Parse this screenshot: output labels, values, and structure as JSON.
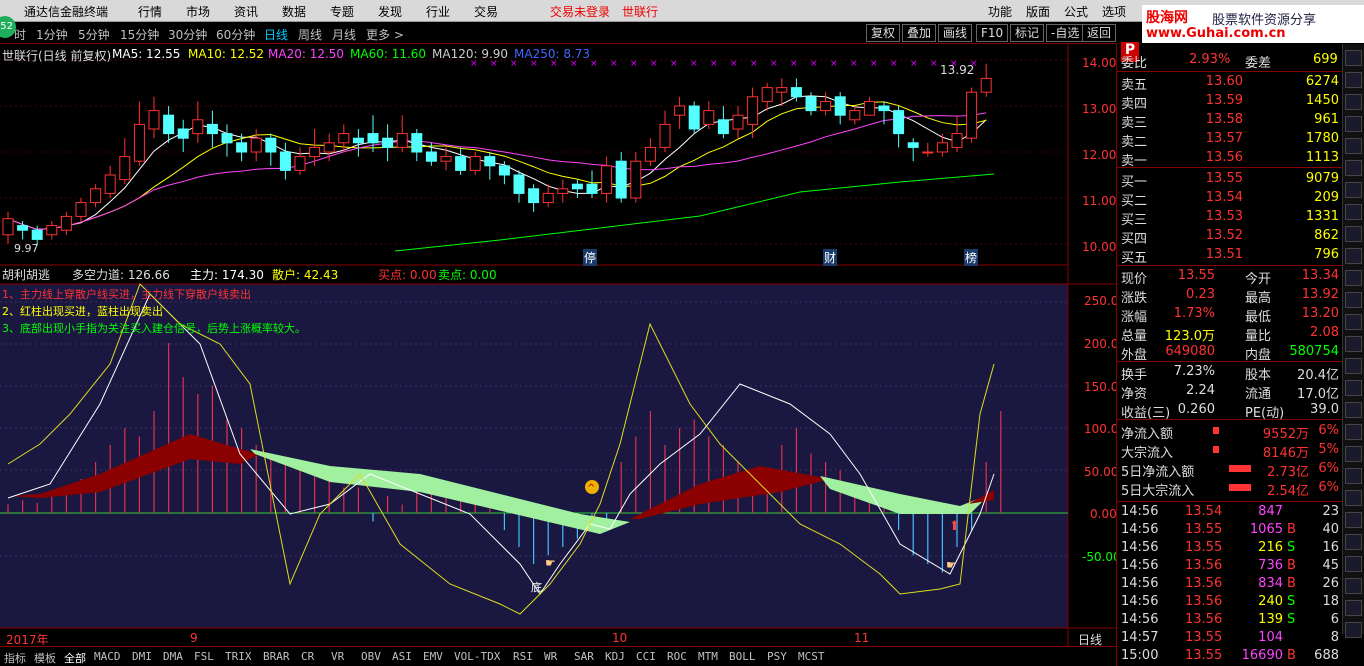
{
  "menu": {
    "items": [
      "通达信金融终端",
      "行情",
      "市场",
      "资讯",
      "数据",
      "专题",
      "发现",
      "行业",
      "交易"
    ],
    "trade_status": "交易未登录",
    "stock_name": "世联行",
    "right_items": [
      "功能",
      "版面",
      "公式",
      "选项"
    ]
  },
  "logo_text": "52",
  "watermark": {
    "line1": "股海网",
    "line2": "股票软件资源分享",
    "line3": "www.Guhai.com.cn"
  },
  "periods": [
    "时",
    "1分钟",
    "5分钟",
    "15分钟",
    "30分钟",
    "60分钟",
    "日线",
    "周线",
    "月线",
    "更多 >"
  ],
  "active_period": "日线",
  "tools": [
    "复权",
    "叠加",
    "画线",
    "F10",
    "标记",
    "-自选",
    "返回"
  ],
  "ma_legend": {
    "title": "世联行(日线 前复权)",
    "ma5": "MA5: 12.55",
    "ma10": "MA10: 12.52",
    "ma20": "MA20: 12.50",
    "ma60": "MA60: 11.60",
    "ma120": "MA120: 9.90",
    "ma250": "MA250: 8.73",
    "colors": {
      "ma5": "#ffffff",
      "ma10": "#ffff00",
      "ma20": "#ff40ff",
      "ma60": "#00ff00",
      "ma120": "#c0c0c0",
      "ma250": "#4060ff"
    }
  },
  "price_axis": [
    "14.00",
    "13.00",
    "12.00",
    "11.00",
    "10.00"
  ],
  "price_annotations": {
    "high": "13.92",
    "low": "9.97",
    "markers": [
      "停",
      "财",
      "榜"
    ]
  },
  "indicator": {
    "name": "胡利胡逃",
    "dkd": "多空力道: 126.66",
    "zl": "主力: 174.30",
    "sh": "散户: 42.43",
    "buy": "买点: 0.00",
    "sell": "卖点: 0.00",
    "note1": "1、主力线上穿散户线买进，主力线下穿散户线卖出",
    "note2": "2、红柱出现买进，蓝柱出现卖出",
    "note3": "3、底部出现小手指为关注买入建仓信号，后势上涨概率较大。",
    "axis": [
      "250.00",
      "200.00",
      "150.00",
      "100.00",
      "50.00",
      "0.00",
      "-50.00"
    ],
    "low_label": "底"
  },
  "time_axis": {
    "year": "2017年",
    "m9": "9",
    "m10": "10",
    "m11": "11",
    "period": "日线"
  },
  "order_book": {
    "wb_label": "委比",
    "wb_value": "2.93%",
    "wc_label": "委差",
    "wc_value": "699",
    "asks": [
      {
        "label": "卖五",
        "price": "13.60",
        "vol": "6274"
      },
      {
        "label": "卖四",
        "price": "13.59",
        "vol": "1450"
      },
      {
        "label": "卖三",
        "price": "13.58",
        "vol": "961"
      },
      {
        "label": "卖二",
        "price": "13.57",
        "vol": "1780"
      },
      {
        "label": "卖一",
        "price": "13.56",
        "vol": "1113"
      }
    ],
    "bids": [
      {
        "label": "买一",
        "price": "13.55",
        "vol": "9079"
      },
      {
        "label": "买二",
        "price": "13.54",
        "vol": "209"
      },
      {
        "label": "买三",
        "price": "13.53",
        "vol": "1331"
      },
      {
        "label": "买四",
        "price": "13.52",
        "vol": "862"
      },
      {
        "label": "买五",
        "price": "13.51",
        "vol": "796"
      }
    ]
  },
  "quote": [
    {
      "l1": "现价",
      "v1": "13.55",
      "l2": "今开",
      "v2": "13.34"
    },
    {
      "l1": "涨跌",
      "v1": "0.23",
      "l2": "最高",
      "v2": "13.92"
    },
    {
      "l1": "涨幅",
      "v1": "1.73%",
      "l2": "最低",
      "v2": "13.20"
    },
    {
      "l1": "总量",
      "v1": "123.0万",
      "l2": "量比",
      "v2": "2.08"
    },
    {
      "l1": "外盘",
      "v1": "649080",
      "l2": "内盘",
      "v2": "580754"
    }
  ],
  "fund": [
    {
      "l1": "换手",
      "v1": "7.23%",
      "l2": "股本",
      "v2": "20.4亿"
    },
    {
      "l1": "净资",
      "v1": "2.24",
      "l2": "流通",
      "v2": "17.0亿"
    },
    {
      "l1": "收益(三)",
      "v1": "0.260",
      "l2": "PE(动)",
      "v2": "39.0"
    }
  ],
  "flow": [
    {
      "label": "净流入额",
      "value": "9552万",
      "pct": "6%"
    },
    {
      "label": "大宗流入",
      "value": "8146万",
      "pct": "5%"
    },
    {
      "label": "5日净流入额",
      "value": "2.73亿",
      "pct": "6%"
    },
    {
      "label": "5日大宗流入",
      "value": "2.54亿",
      "pct": "6%"
    }
  ],
  "ticks": [
    {
      "time": "14:56",
      "price": "13.54",
      "vol": "847",
      "bs": "",
      "n": "23"
    },
    {
      "time": "14:56",
      "price": "13.55",
      "vol": "1065",
      "bs": "B",
      "n": "40"
    },
    {
      "time": "14:56",
      "price": "13.55",
      "vol": "216",
      "bs": "S",
      "n": "16"
    },
    {
      "time": "14:56",
      "price": "13.56",
      "vol": "736",
      "bs": "B",
      "n": "45"
    },
    {
      "time": "14:56",
      "price": "13.56",
      "vol": "834",
      "bs": "B",
      "n": "26"
    },
    {
      "time": "14:56",
      "price": "13.56",
      "vol": "240",
      "bs": "S",
      "n": "18"
    },
    {
      "time": "14:56",
      "price": "13.56",
      "vol": "139",
      "bs": "S",
      "n": "6"
    },
    {
      "time": "14:57",
      "price": "13.55",
      "vol": "104",
      "bs": "",
      "n": "8"
    },
    {
      "time": "15:00",
      "price": "13.55",
      "vol": "16690",
      "bs": "B",
      "n": "688"
    }
  ],
  "bottom_tabs": [
    "指标",
    "模板",
    "全部",
    "MACD",
    "DMI",
    "DMA",
    "FSL",
    "TRIX",
    "BRAR",
    "CR",
    "VR",
    "OBV",
    "ASI",
    "EMV",
    "VOL-TDX",
    "RSI",
    "WR",
    "SAR",
    "KDJ",
    "CCI",
    "ROC",
    "MTM",
    "BOLL",
    "PSY",
    "MCST"
  ],
  "active_bottom_tab": "全部",
  "right_tab_letter": "P",
  "colors": {
    "up": "#ff3232",
    "down": "#54ffff",
    "frame": "#880000"
  }
}
